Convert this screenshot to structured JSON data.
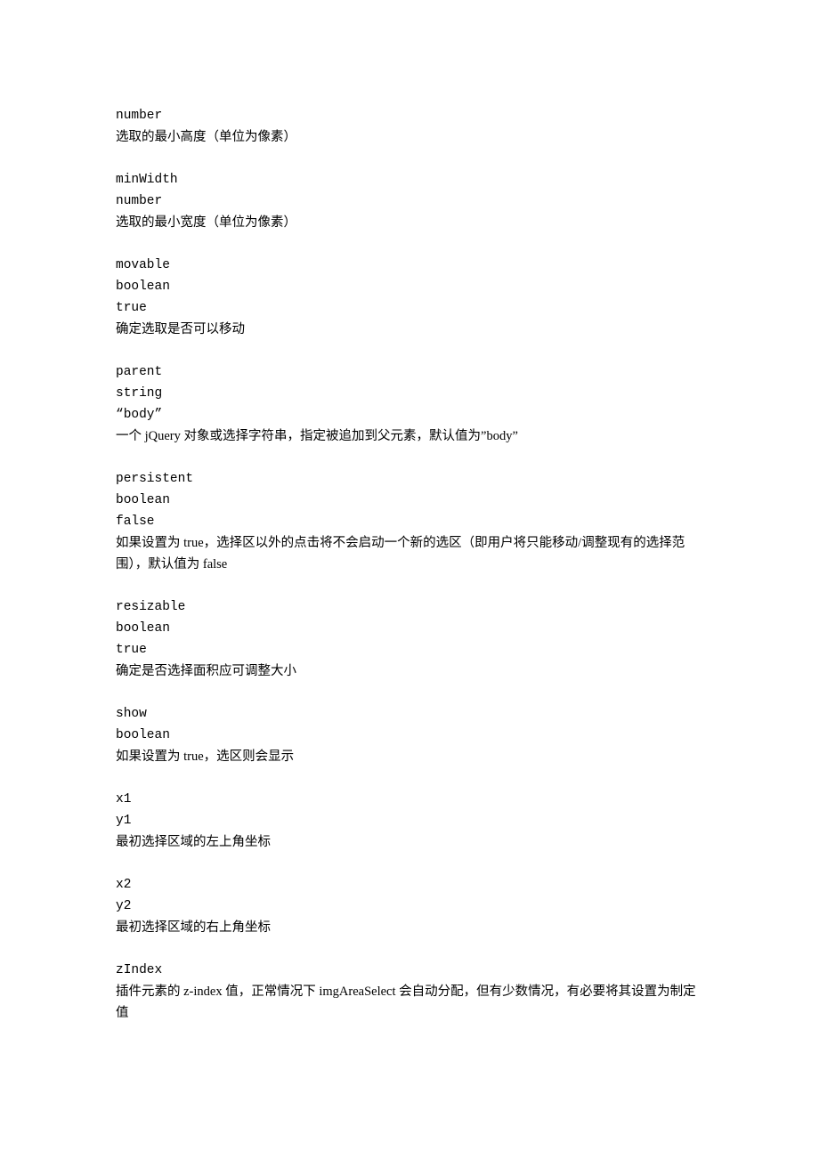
{
  "entries": [
    {
      "name": "number",
      "type": null,
      "default": null,
      "desc": "选取的最小高度（单位为像素）"
    },
    {
      "name": "minWidth",
      "type": "number",
      "default": null,
      "desc": "选取的最小宽度（单位为像素）"
    },
    {
      "name": "movable",
      "type": "boolean",
      "default": "true",
      "desc": "确定选取是否可以移动"
    },
    {
      "name": "parent",
      "type": "string",
      "default": "“body”",
      "desc": "一个 jQuery 对象或选择字符串，指定被追加到父元素，默认值为”body”"
    },
    {
      "name": "persistent",
      "type": "boolean",
      "default": "false",
      "desc": "如果设置为 true，选择区以外的点击将不会启动一个新的选区（即用户将只能移动/调整现有的选择范围），默认值为 false"
    },
    {
      "name": "resizable",
      "type": "boolean",
      "default": "true",
      "desc": "确定是否选择面积应可调整大小"
    },
    {
      "name": "show",
      "type": "boolean",
      "default": null,
      "desc": "如果设置为 true，选区则会显示"
    },
    {
      "name": "x1",
      "type": "y1",
      "default": null,
      "desc": "最初选择区域的左上角坐标"
    },
    {
      "name": "x2",
      "type": "y2",
      "default": null,
      "desc": "最初选择区域的右上角坐标"
    },
    {
      "name": "zIndex",
      "type": null,
      "default": null,
      "desc": "插件元素的 z-index 值，正常情况下 imgAreaSelect 会自动分配，但有少数情况，有必要将其设置为制定值"
    }
  ]
}
